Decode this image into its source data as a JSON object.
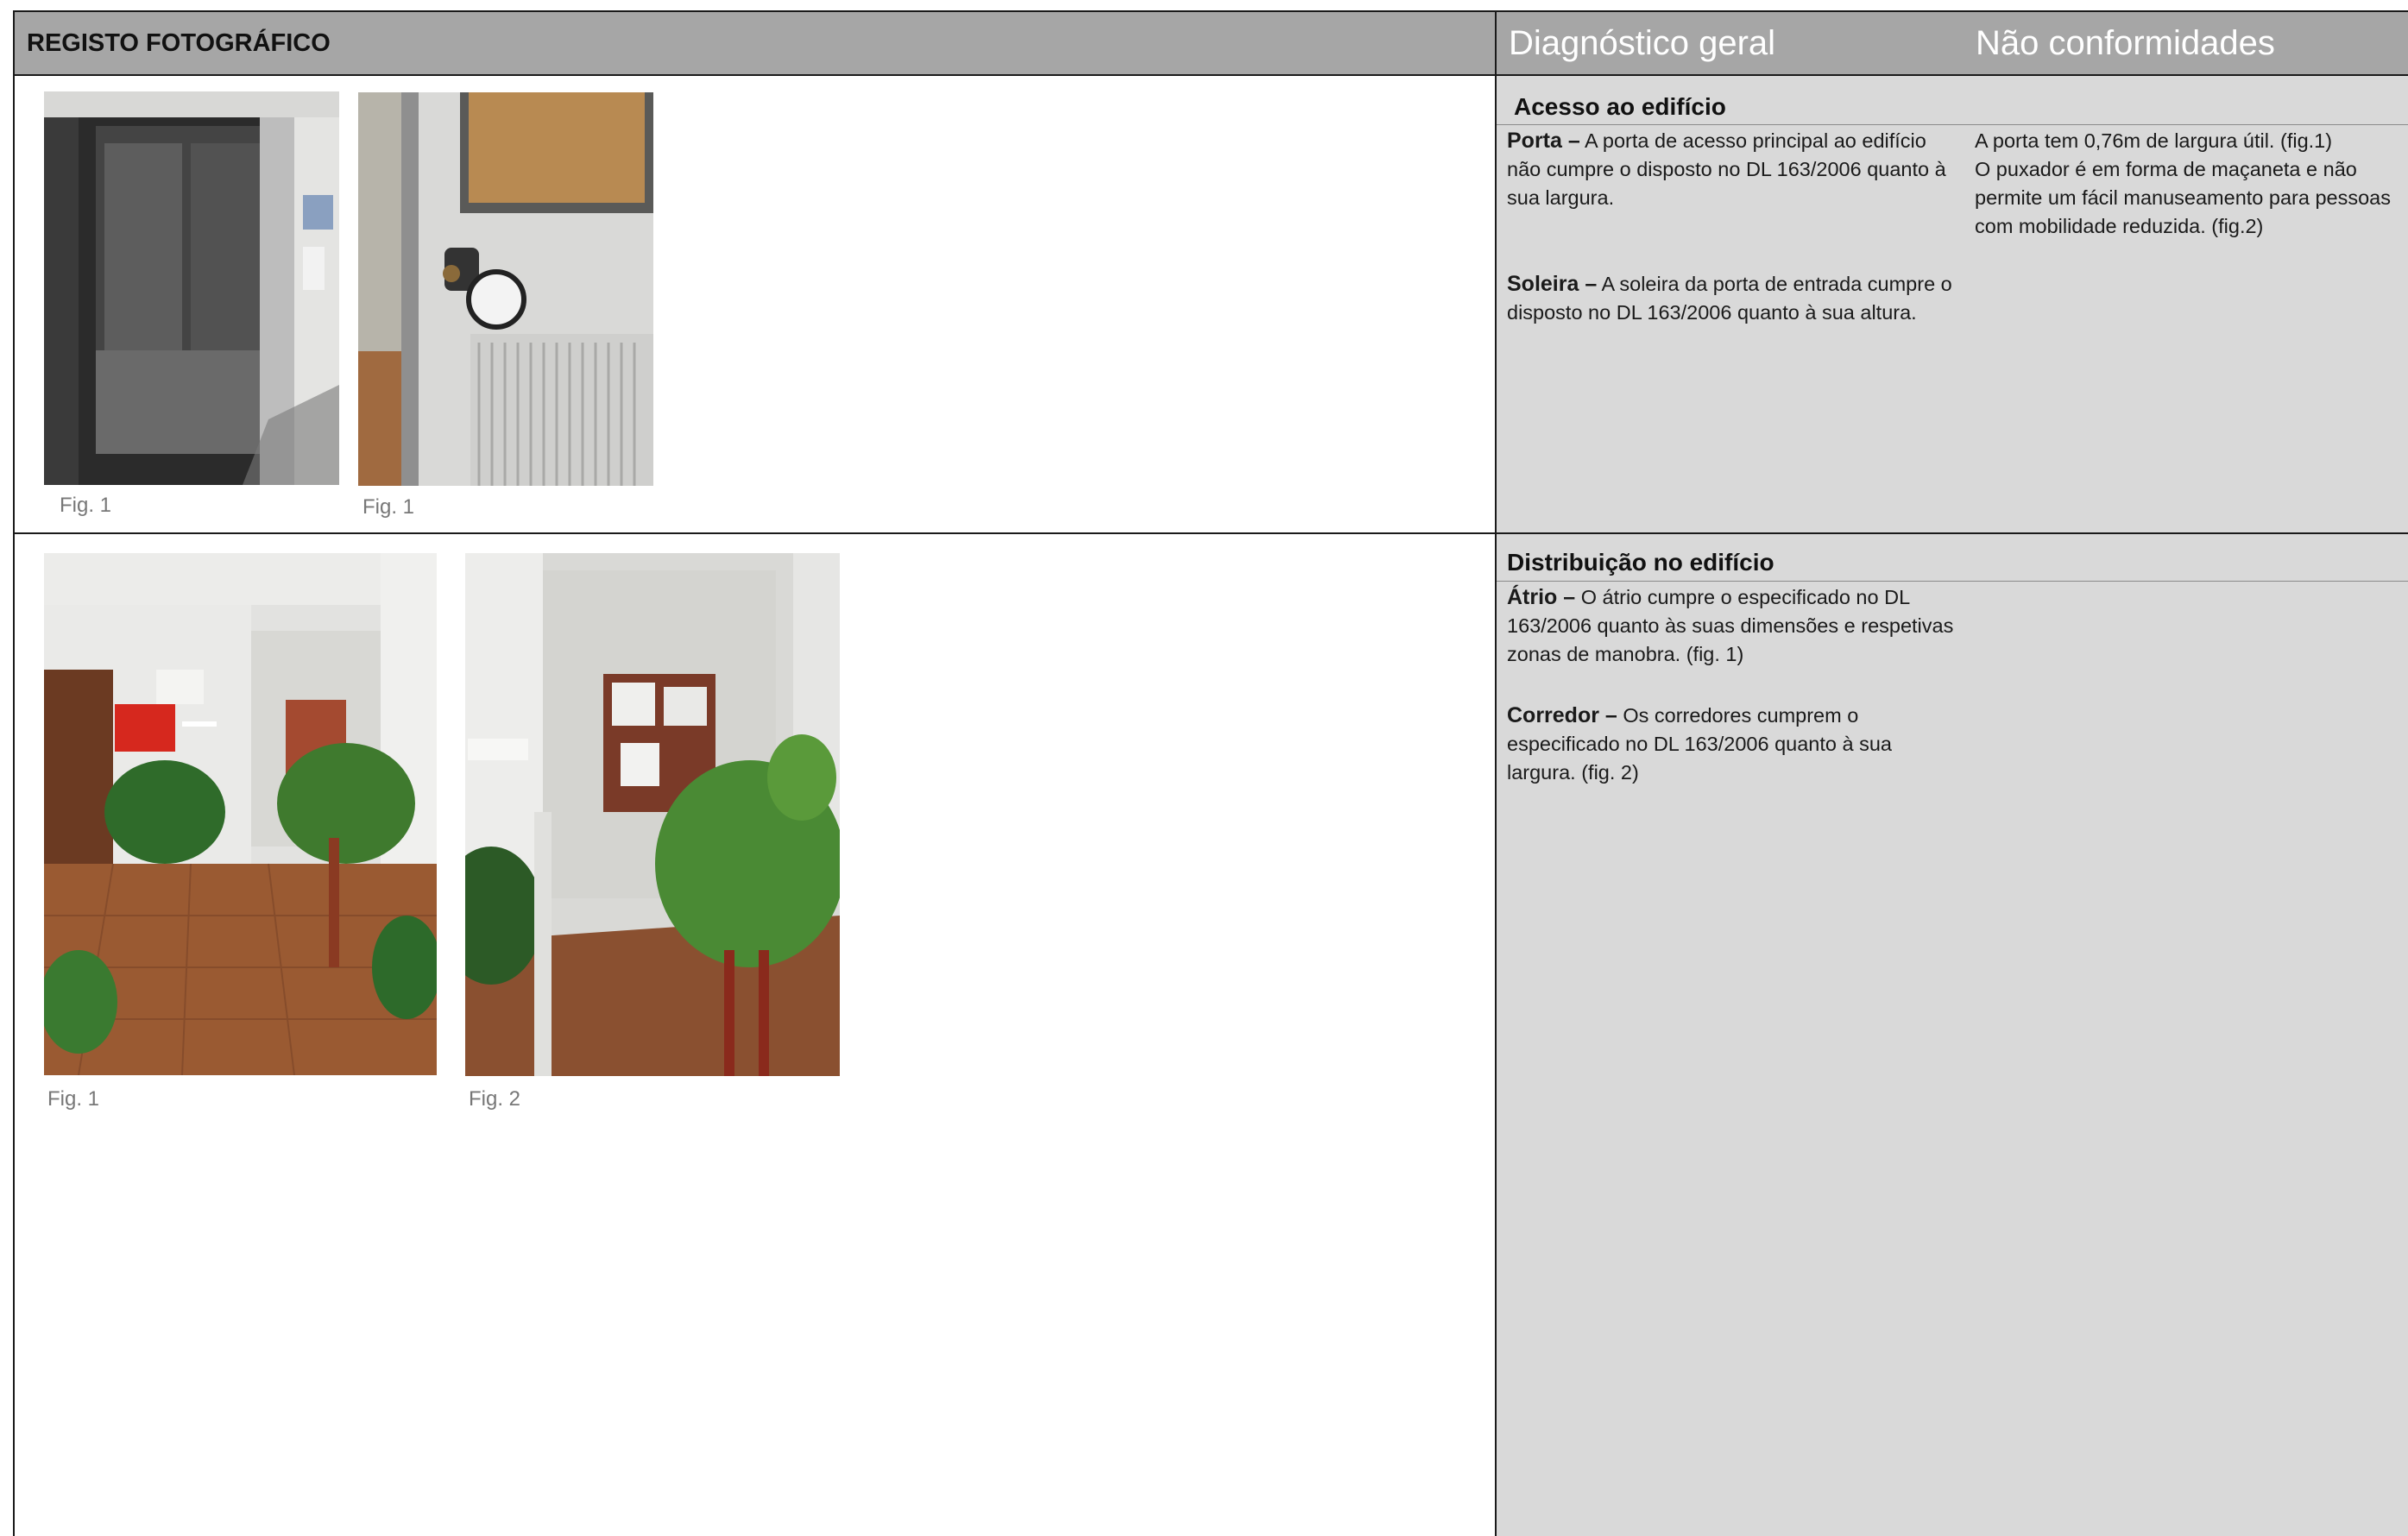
{
  "header": {
    "left_title": "REGISTO FOTOGRÁFICO",
    "col_diagnostic": "Diagnóstico geral",
    "col_nonconformities": "Não conformidades"
  },
  "section1": {
    "title": "Acesso ao edifício",
    "items": [
      {
        "term": "Porta –",
        "text": "A porta de acesso principal ao edifício não cumpre o disposto no DL 163/2006 quanto à sua largura."
      },
      {
        "term": "Soleira –",
        "text": "A soleira da porta de entrada cumpre o disposto no DL 163/2006 quanto à sua altura."
      }
    ],
    "nonconformities": [
      "A porta tem 0,76m de largura útil. (fig.1)",
      "O puxador é em forma de maçaneta e não",
      "permite um fácil manuseamento para pessoas",
      "com mobilidade reduzida. (fig.2)"
    ],
    "captions": [
      "Fig. 1",
      "Fig. 1"
    ]
  },
  "section2": {
    "title": "Distribuição no edifício",
    "items": [
      {
        "term": "Átrio –",
        "text": "O átrio cumpre o especificado no DL 163/2006 quanto às suas dimensões e respetivas zonas de manobra. (fig. 1)"
      },
      {
        "term": "Corredor –",
        "text": "Os corredores cumprem o especificado no DL 163/2006 quanto à sua largura. (fig. 2)"
      }
    ],
    "captions": [
      "Fig. 1",
      "Fig. 2"
    ]
  }
}
